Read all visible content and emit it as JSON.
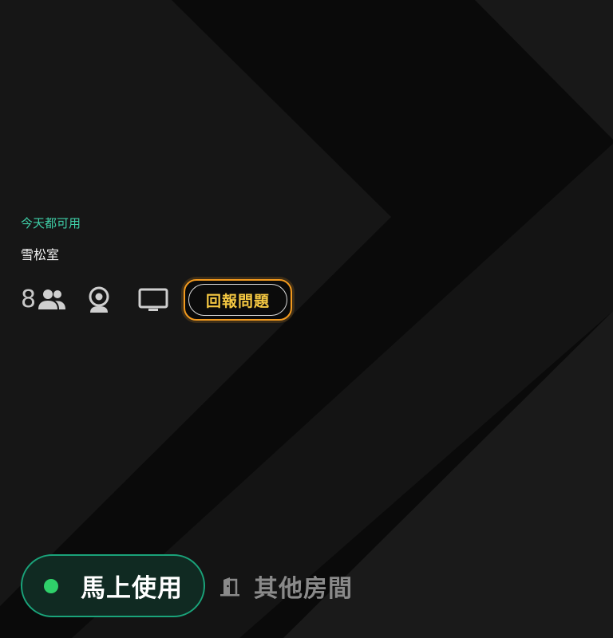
{
  "room": {
    "availability": "今天都可用",
    "name": "雪松室",
    "capacity": "8"
  },
  "amenities": {
    "capacity_icon": "people-icon",
    "camera_icon": "webcam-icon",
    "display_icon": "monitor-icon"
  },
  "actions": {
    "report_label": "回報問題",
    "use_now_label": "馬上使用",
    "other_rooms_label": "其他房間",
    "other_rooms_icon": "door-icon"
  },
  "colors": {
    "availability": "#3fd0a8",
    "accent_orange": "#f39a1e",
    "report_text": "#f5c842",
    "use_now_border": "#1aa37a",
    "status_dot": "#2fd06a"
  }
}
